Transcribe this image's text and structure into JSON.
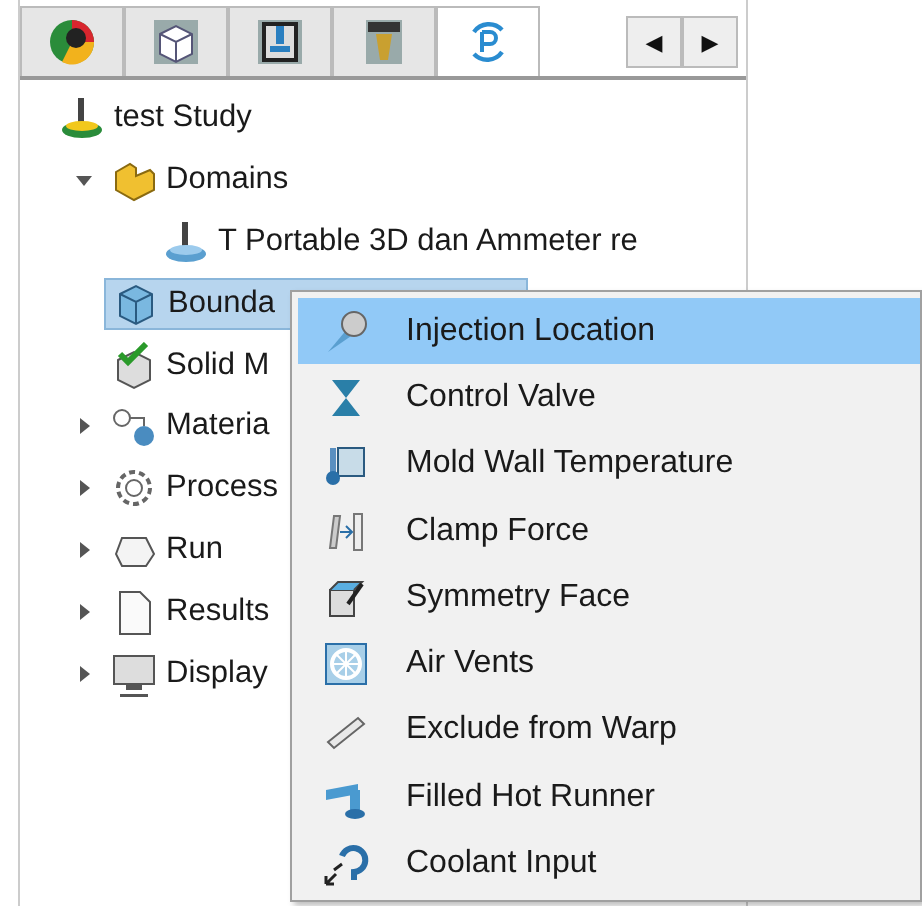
{
  "tabs": [
    {
      "selected": false
    },
    {
      "selected": false
    },
    {
      "selected": false
    },
    {
      "selected": false
    },
    {
      "selected": true
    }
  ],
  "tab_scroll": [
    "◀",
    "▶"
  ],
  "tree": {
    "label": "test Study",
    "children": [
      {
        "label": "Domains",
        "expanded": true,
        "selected": false,
        "children": [
          {
            "label": "T Portable 3D dan Ammeter re",
            "selected": false
          }
        ]
      },
      {
        "label": "Bounda",
        "selected": true
      },
      {
        "label": "Solid M",
        "selected": false
      },
      {
        "label": "Materia",
        "expanded": false,
        "selected": false
      },
      {
        "label": "Process",
        "expanded": false,
        "selected": false
      },
      {
        "label": "Run",
        "expanded": false,
        "selected": false
      },
      {
        "label": "Results",
        "expanded": false,
        "selected": false
      },
      {
        "label": "Display",
        "expanded": false,
        "selected": false
      }
    ]
  },
  "context_menu": [
    {
      "label": "Injection Location",
      "selected": true
    },
    {
      "label": "Control Valve",
      "selected": false
    },
    {
      "label": "Mold Wall Temperature",
      "selected": false
    },
    {
      "label": "Clamp Force",
      "selected": false
    },
    {
      "label": "Symmetry Face",
      "selected": false
    },
    {
      "label": "Air Vents",
      "selected": false
    },
    {
      "label": "Exclude from Warp",
      "selected": false
    },
    {
      "label": "Filled Hot Runner",
      "selected": false
    },
    {
      "label": "Coolant Input",
      "selected": false
    }
  ]
}
